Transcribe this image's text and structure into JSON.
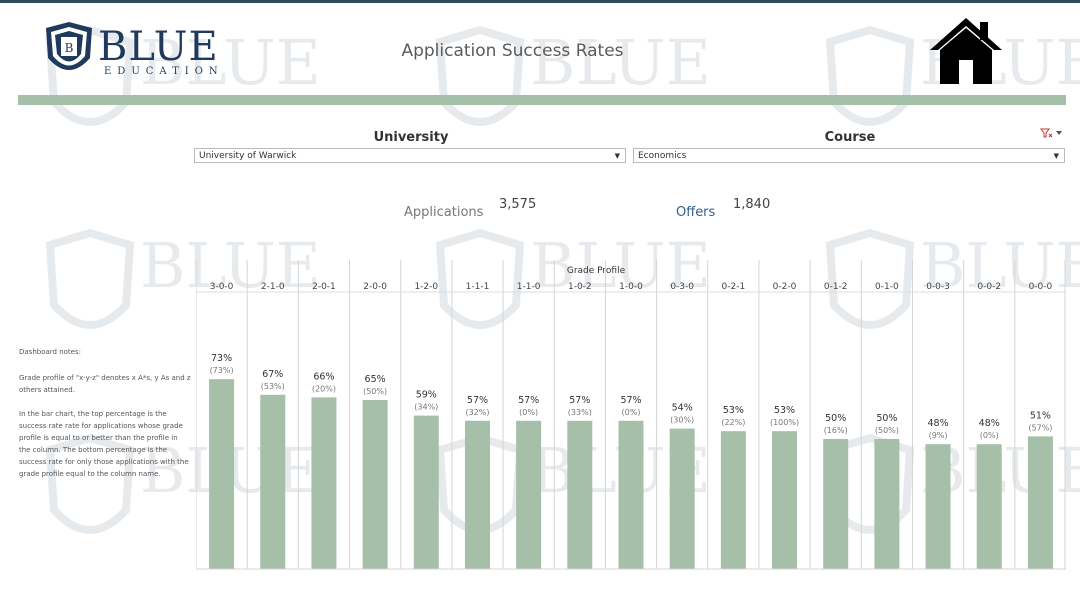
{
  "brand": {
    "name": "BLUE",
    "sub": "EDUCATION",
    "badge_letter": "B"
  },
  "header": {
    "title": "Application Success Rates",
    "home_icon": "home-icon"
  },
  "filters": {
    "university_label": "University",
    "university_value": "University of Warwick",
    "course_label": "Course",
    "course_value": "Economics",
    "filter_icon": "filter-clear-icon"
  },
  "kpis": {
    "applications_label": "Applications",
    "applications_value": "3,575",
    "offers_label": "Offers",
    "offers_value": "1,840"
  },
  "notes": {
    "title": "Dashboard notes:",
    "p1": "Grade profile of \"x-y-z\" denotes x A*s, y As and z others attained.",
    "p2": "In the bar chart, the top percentage is the success rate rate for applications whose grade profile is equal to or better than the profile in the column. The bottom percentage is the success rate for only those applications with the grade profile equal to the column name."
  },
  "colors": {
    "bar": "#a5bfa8",
    "brand": "#1f3a5c",
    "offers": "#2f5f8a",
    "applications": "#777777"
  },
  "chart_data": {
    "type": "bar",
    "title": "Grade Profile",
    "categories": [
      "3-0-0",
      "2-1-0",
      "2-0-1",
      "2-0-0",
      "1-2-0",
      "1-1-1",
      "1-1-0",
      "1-0-2",
      "1-0-0",
      "0-3-0",
      "0-2-1",
      "0-2-0",
      "0-1-2",
      "0-1-0",
      "0-0-3",
      "0-0-2",
      "0-0-0"
    ],
    "series": [
      {
        "values": [
          73,
          67,
          66,
          65,
          59,
          57,
          57,
          57,
          57,
          54,
          53,
          53,
          50,
          50,
          48,
          48,
          51
        ]
      },
      {
        "values": [
          73,
          53,
          20,
          50,
          34,
          32,
          0,
          33,
          0,
          30,
          22,
          100,
          16,
          50,
          9,
          0,
          57
        ]
      }
    ],
    "value_labels": [
      "73%",
      "67%",
      "66%",
      "65%",
      "59%",
      "57%",
      "57%",
      "57%",
      "57%",
      "54%",
      "53%",
      "53%",
      "50%",
      "50%",
      "48%",
      "48%",
      "51%"
    ],
    "secondary_labels": [
      "(73%)",
      "(53%)",
      "(20%)",
      "(50%)",
      "(34%)",
      "(32%)",
      "(0%)",
      "(33%)",
      "(0%)",
      "(30%)",
      "(22%)",
      "(100%)",
      "(16%)",
      "(50%)",
      "(9%)",
      "(0%)",
      "(57%)"
    ],
    "ylim": [
      0,
      100
    ],
    "grid": false
  }
}
